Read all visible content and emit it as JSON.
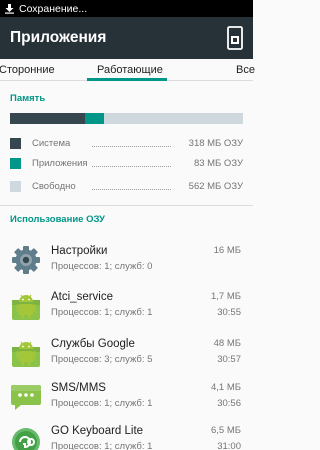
{
  "status_bar": {
    "notification_text": "Сохранение..."
  },
  "action_bar": {
    "title": "Приложения"
  },
  "tabs": [
    {
      "label": "Сторонние",
      "selected": false
    },
    {
      "label": "Работающие",
      "selected": true
    },
    {
      "label": "Все",
      "selected": false
    }
  ],
  "memory": {
    "header": "Память",
    "bar_fractions": {
      "system": 0.321,
      "apps": 0.084,
      "free": 0.595
    },
    "legend": [
      {
        "label": "Система",
        "value": "318 МБ ОЗУ",
        "color": "#37474f"
      },
      {
        "label": "Приложения",
        "value": "83 МБ ОЗУ",
        "color": "#009688"
      },
      {
        "label": "Свободно",
        "value": "562 МБ ОЗУ",
        "color": "#cfd8dc"
      }
    ]
  },
  "ram_usage": {
    "header": "Использование ОЗУ",
    "apps": [
      {
        "name": "Настройки",
        "info": "Процессов: 1; служб: 0",
        "size": "16 МБ",
        "time": "",
        "icon": "settings-gear-icon"
      },
      {
        "name": "Atci_service",
        "info": "Процессов: 1; служб: 1",
        "size": "1,7 МБ",
        "time": "30:55",
        "icon": "android-icon"
      },
      {
        "name": "Службы Google",
        "info": "Процессов: 3; служб: 5",
        "size": "48 МБ",
        "time": "30:57",
        "icon": "android-icon"
      },
      {
        "name": "SMS/MMS",
        "info": "Процессов: 1; служб: 1",
        "size": "4,1 МБ",
        "time": "30:56",
        "icon": "sms-bubble-icon"
      },
      {
        "name": "GO Keyboard Lite",
        "info": "Процессов: 1; служб: 1",
        "size": "6,5 МБ",
        "time": "31:00",
        "icon": "go-keyboard-icon"
      }
    ]
  }
}
